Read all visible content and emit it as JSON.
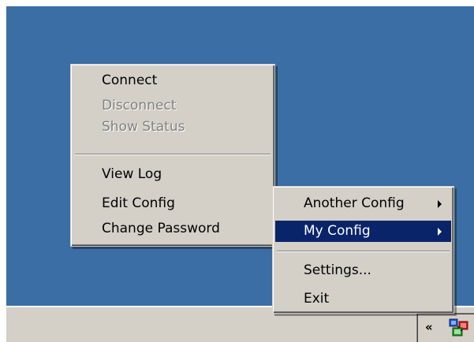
{
  "main_menu": {
    "items": [
      {
        "label": "Connect",
        "enabled": true
      },
      {
        "label": "Disconnect",
        "enabled": false
      },
      {
        "label": "Show Status",
        "enabled": false
      },
      {
        "label": "View Log",
        "enabled": true
      },
      {
        "label": "Edit Config",
        "enabled": true
      },
      {
        "label": "Change Password",
        "enabled": true
      }
    ]
  },
  "tray_menu": {
    "configs": [
      {
        "label": "Another Config",
        "has_submenu": true,
        "selected": false
      },
      {
        "label": "My Config",
        "has_submenu": true,
        "selected": true
      }
    ],
    "items": [
      {
        "label": "Settings..."
      },
      {
        "label": "Exit"
      }
    ]
  },
  "taskbar": {
    "tray_chevron": "«",
    "tray_icon": "network-monitor-icon"
  },
  "colors": {
    "desktop": "#3a6ea5",
    "menu_bg": "#d4d0c8",
    "highlight": "#0a246a",
    "disabled_text": "#808080"
  }
}
